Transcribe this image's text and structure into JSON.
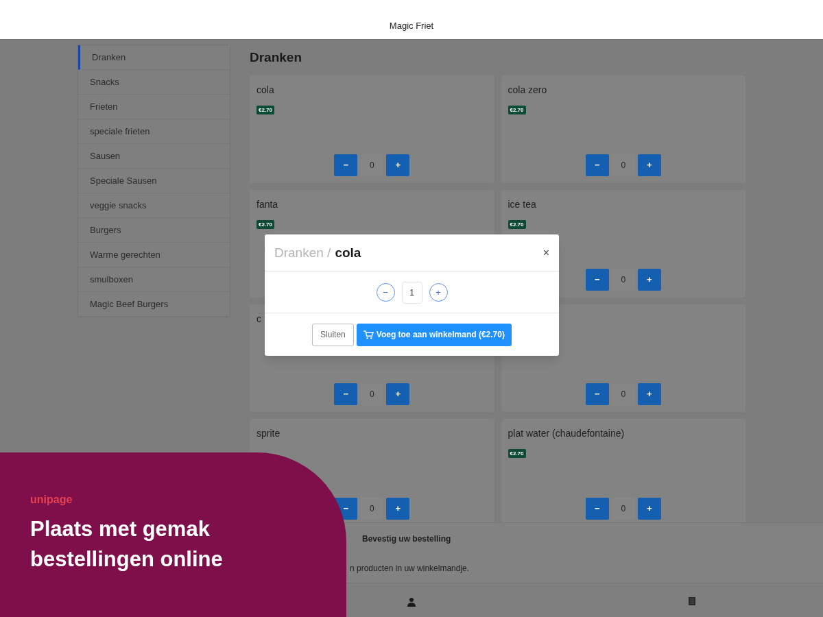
{
  "header": {
    "title": "Magic Friet"
  },
  "sidebar": {
    "items": [
      {
        "label": "Dranken",
        "selected": true
      },
      {
        "label": "Snacks",
        "selected": false
      },
      {
        "label": "Frieten",
        "selected": false
      },
      {
        "label": "speciale frieten",
        "selected": false
      },
      {
        "label": "Sausen",
        "selected": false
      },
      {
        "label": "Speciale Sausen",
        "selected": false
      },
      {
        "label": "veggie snacks",
        "selected": false
      },
      {
        "label": "Burgers",
        "selected": false
      },
      {
        "label": "Warme gerechten",
        "selected": false
      },
      {
        "label": "smulboxen",
        "selected": false
      },
      {
        "label": "Magic Beef Burgers",
        "selected": false
      }
    ]
  },
  "section": {
    "title": "Dranken"
  },
  "products": [
    {
      "name": "cola",
      "price": "€2.70",
      "minus": "−",
      "quantity": "0",
      "plus": "+"
    },
    {
      "name": "cola zero",
      "price": "€2.70",
      "minus": "−",
      "quantity": "0",
      "plus": "+"
    },
    {
      "name": "fanta",
      "price": "€2.70"
    },
    {
      "name": "ice tea",
      "price": "€2.70",
      "minus": "−",
      "quantity": "0",
      "plus": "+"
    },
    {
      "name": "c",
      "minus": "−",
      "quantity": "0",
      "plus": "+"
    },
    {
      "minus": "−",
      "quantity": "0",
      "plus": "+"
    },
    {
      "name": "sprite",
      "minus": "−",
      "quantity": "0",
      "plus": "+"
    },
    {
      "name": "plat water (chaudefontaine)",
      "price": "€2.70",
      "minus": "−",
      "quantity": "0",
      "plus": "+"
    }
  ],
  "modal": {
    "breadcrumb": "Dranken /",
    "title": "cola",
    "close": "×",
    "minus": "−",
    "quantity": "1",
    "plus": "+",
    "buttons": [
      {
        "label": "Sluiten",
        "kind": "secondary"
      },
      {
        "label": "Voeg toe aan winkelmand (€2.70)",
        "kind": "primary"
      }
    ]
  },
  "order_bar": {
    "title": "Bevestig uw bestelling",
    "message": "n producten in uw winkelmandje."
  },
  "promo": {
    "brand": "unipage",
    "headline": "Plaats met gemak bestellingen online"
  }
}
